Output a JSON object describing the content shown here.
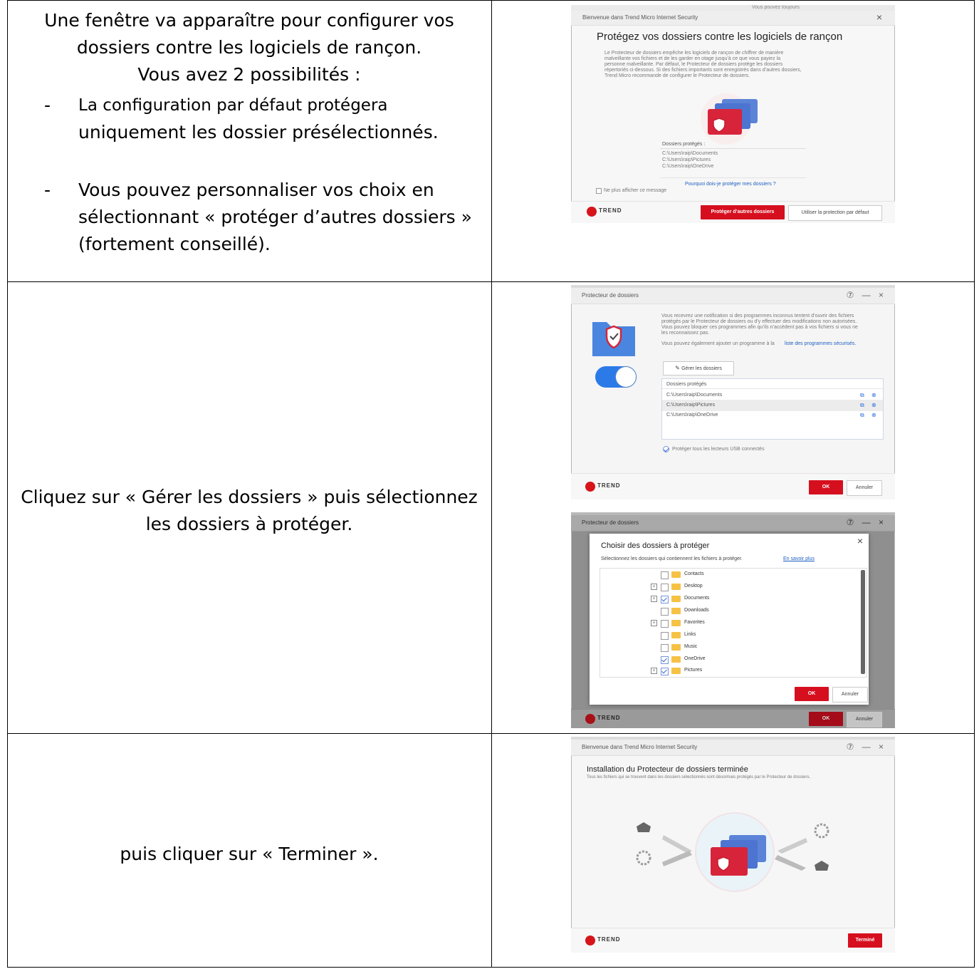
{
  "rows": [
    {
      "text_lines": [
        "Une fenêtre va apparaître pour configurer vos",
        "dossiers contre les logiciels de rançon.",
        "Vous avez 2 possibilités :"
      ],
      "bullets": [
        {
          "marker": "-",
          "lines": [
            "La configuration par défaut protégera",
            "uniquement les dossier présélectionnés."
          ]
        },
        {
          "marker": "-",
          "lines": [
            "Vous pouvez personnaliser vos choix en",
            "sélectionnant « protéger d’autres dossiers »",
            "(fortement conseillé)."
          ]
        }
      ],
      "screenshot": {
        "top_strip": "Vous pouvez toujours",
        "window_title": "Bienvenue dans Trend Micro Internet Security",
        "close": "×",
        "heading": "Protégez vos dossiers contre les logiciels de rançon",
        "description": [
          "Le Protecteur de dossiers empêche les logiciels de rançon de chiffrer de manière",
          "malveillante vos fichiers et de les garder en otage jusqu’à ce que vous payiez la",
          "personne malveillante. Par défaut, le Protecteur de dossiers protège les dossiers",
          "répertoriés ci-dessous. Si des fichiers importants sont enregistrés dans d’autres dossiers,",
          "Trend Micro recommande de configurer le Protecteur de dossiers."
        ],
        "folders_label": "Dossiers protégés :",
        "folders": [
          "C:\\Users\\raip\\Documents",
          "C:\\Users\\raip\\Pictures",
          "C:\\Users\\raip\\OneDrive"
        ],
        "why_link": "Pourquoi dois-je protéger mes dossiers ?",
        "dont_show": "Ne plus afficher ce message",
        "brand": "TREND",
        "btn_primary": "Protéger d’autres dossiers",
        "btn_default": "Utiliser la protection par défaut"
      }
    },
    {
      "text_lines": [
        "Cliquez sur « Gérer les dossiers » puis sélectionnez",
        "les dossiers à protéger."
      ],
      "screenshot_a": {
        "window_title": "Protecteur de dossiers",
        "controls": "⑦ — ×",
        "info1": [
          "Vous recevrez une notification si des programmes inconnus tentent d’ouvrir des fichiers",
          "protégés par le Protecteur de dossiers ou d’y effectuer des modifications non autorisées.",
          "Vous pouvez bloquer ces programmes afin qu’ils n’accèdent pas à vos fichiers si vous ne",
          "les reconnaissez pas."
        ],
        "info2_prefix": "Vous pouvez également ajouter un programme à la",
        "info2_link": "liste des programmes sécurisés.",
        "manage_btn": "Gérer les dossiers",
        "list_header": "Dossiers protégés",
        "folders": [
          "C:\\Users\\raip\\Documents",
          "C:\\Users\\raip\\Pictures",
          "C:\\Users\\raip\\OneDrive"
        ],
        "usb": "Protéger tous les lecteurs USB connectés",
        "brand": "TREND",
        "ok": "OK",
        "cancel": "Annuler"
      },
      "screenshot_b": {
        "window_title": "Protecteur de dossiers",
        "controls": "⑦ — ×",
        "dialog_title": "Choisir des dossiers à protéger",
        "dialog_close": "×",
        "dialog_desc": "Sélectionnez les dossiers qui contiennent les fichiers à protéger.",
        "dialog_link": "En savoir plus",
        "tree": [
          {
            "label": "Contacts",
            "checked": false,
            "expand": false
          },
          {
            "label": "Desktop",
            "checked": false,
            "expand": true
          },
          {
            "label": "Documents",
            "checked": true,
            "expand": true
          },
          {
            "label": "Downloads",
            "checked": false,
            "expand": false
          },
          {
            "label": "Favorites",
            "checked": false,
            "expand": true
          },
          {
            "label": "Links",
            "checked": false,
            "expand": false
          },
          {
            "label": "Music",
            "checked": false,
            "expand": false
          },
          {
            "label": "OneDrive",
            "checked": true,
            "expand": false
          },
          {
            "label": "Pictures",
            "checked": true,
            "expand": true
          }
        ],
        "plus_glyph": "+",
        "ok": "OK",
        "cancel": "Annuler",
        "brand": "TREND"
      }
    },
    {
      "text_lines": [
        "puis cliquer sur « Terminer »."
      ],
      "screenshot": {
        "window_title": "Bienvenue dans Trend Micro Internet Security",
        "controls": "⑦ — ×",
        "heading": "Installation du Protecteur de dossiers terminée",
        "subheading": "Tous les fichiers qui se trouvent dans les dossiers sélectionnés sont désormais protégés par le Protecteur de dossiers.",
        "brand": "TREND",
        "finish": "Terminé"
      }
    }
  ],
  "colors": {
    "accent_red": "#d60f1f",
    "link_blue": "#1f5fc1",
    "folder_blue": "#3d7ddb"
  }
}
